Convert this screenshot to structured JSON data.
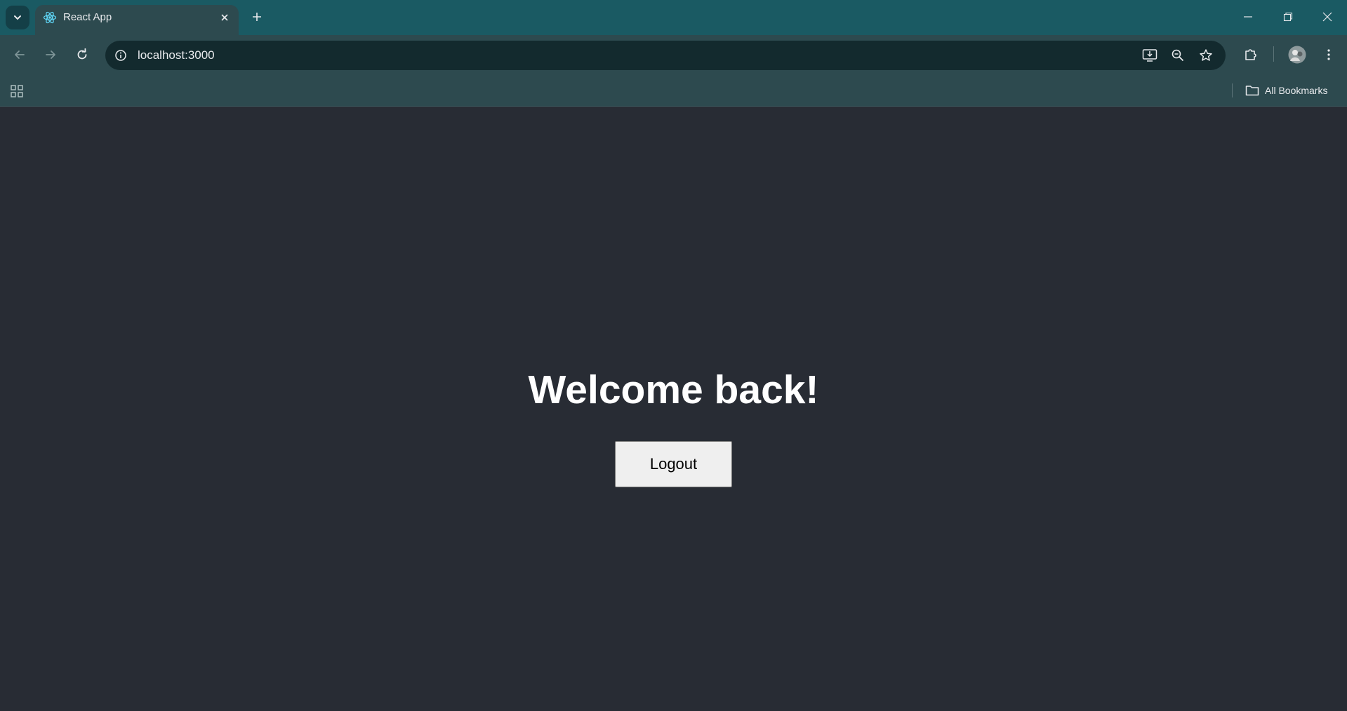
{
  "browser": {
    "tab": {
      "title": "React App",
      "favicon": "react-logo-icon"
    },
    "url": "localhost:3000",
    "bookmarks_bar": {
      "all_bookmarks_label": "All Bookmarks"
    },
    "colors": {
      "frame": "#1a5a63",
      "toolbar": "#2d4a4f",
      "omnibox": "#132a2e"
    }
  },
  "page": {
    "heading": "Welcome back!",
    "logout_label": "Logout",
    "background_color": "#282c34"
  }
}
